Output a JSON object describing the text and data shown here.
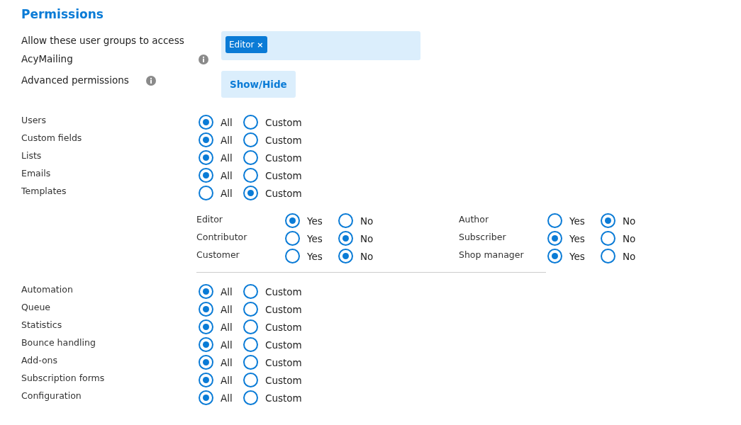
{
  "heading": "Permissions",
  "access": {
    "label": "Allow these user groups to access AcyMailing",
    "tags": [
      {
        "label": "Editor",
        "remove": "×"
      }
    ]
  },
  "advanced": {
    "label": "Advanced permissions",
    "button": "Show/Hide"
  },
  "permissions_top": [
    {
      "label": "Users",
      "options": [
        {
          "label": "All",
          "selected": true
        },
        {
          "label": "Custom",
          "selected": false
        }
      ]
    },
    {
      "label": "Custom fields",
      "options": [
        {
          "label": "All",
          "selected": true
        },
        {
          "label": "Custom",
          "selected": false
        }
      ]
    },
    {
      "label": "Lists",
      "options": [
        {
          "label": "All",
          "selected": true
        },
        {
          "label": "Custom",
          "selected": false
        }
      ]
    },
    {
      "label": "Emails",
      "options": [
        {
          "label": "All",
          "selected": true
        },
        {
          "label": "Custom",
          "selected": false
        }
      ]
    },
    {
      "label": "Templates",
      "options": [
        {
          "label": "All",
          "selected": false
        },
        {
          "label": "Custom",
          "selected": true
        }
      ]
    }
  ],
  "template_groups": [
    {
      "label": "Editor",
      "options": [
        {
          "label": "Yes",
          "selected": true
        },
        {
          "label": "No",
          "selected": false
        }
      ]
    },
    {
      "label": "Author",
      "options": [
        {
          "label": "Yes",
          "selected": false
        },
        {
          "label": "No",
          "selected": true
        }
      ]
    },
    {
      "label": "Contributor",
      "options": [
        {
          "label": "Yes",
          "selected": false
        },
        {
          "label": "No",
          "selected": true
        }
      ]
    },
    {
      "label": "Subscriber",
      "options": [
        {
          "label": "Yes",
          "selected": true
        },
        {
          "label": "No",
          "selected": false
        }
      ]
    },
    {
      "label": "Customer",
      "options": [
        {
          "label": "Yes",
          "selected": false
        },
        {
          "label": "No",
          "selected": true
        }
      ]
    },
    {
      "label": "Shop manager",
      "options": [
        {
          "label": "Yes",
          "selected": true
        },
        {
          "label": "No",
          "selected": false
        }
      ]
    }
  ],
  "permissions_bottom": [
    {
      "label": "Automation",
      "options": [
        {
          "label": "All",
          "selected": true
        },
        {
          "label": "Custom",
          "selected": false
        }
      ]
    },
    {
      "label": "Queue",
      "options": [
        {
          "label": "All",
          "selected": true
        },
        {
          "label": "Custom",
          "selected": false
        }
      ]
    },
    {
      "label": "Statistics",
      "options": [
        {
          "label": "All",
          "selected": true
        },
        {
          "label": "Custom",
          "selected": false
        }
      ]
    },
    {
      "label": "Bounce handling",
      "options": [
        {
          "label": "All",
          "selected": true
        },
        {
          "label": "Custom",
          "selected": false
        }
      ]
    },
    {
      "label": "Add-ons",
      "options": [
        {
          "label": "All",
          "selected": true
        },
        {
          "label": "Custom",
          "selected": false
        }
      ]
    },
    {
      "label": "Subscription forms",
      "options": [
        {
          "label": "All",
          "selected": true
        },
        {
          "label": "Custom",
          "selected": false
        }
      ]
    },
    {
      "label": "Configuration",
      "options": [
        {
          "label": "All",
          "selected": true
        },
        {
          "label": "Custom",
          "selected": false
        }
      ]
    }
  ]
}
